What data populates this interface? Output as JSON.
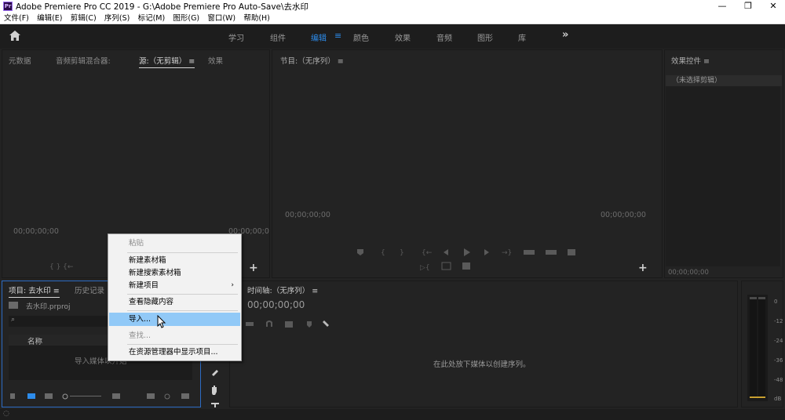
{
  "window": {
    "title": "Adobe Premiere Pro CC 2019 - G:\\Adobe Premiere Pro Auto-Save\\去水印",
    "logo": "Pr",
    "minimize": "—",
    "restore": "❐",
    "close": "✕"
  },
  "menubar": [
    "文件(F)",
    "编辑(E)",
    "剪辑(C)",
    "序列(S)",
    "标记(M)",
    "图形(G)",
    "窗口(W)",
    "帮助(H)"
  ],
  "workspaces": {
    "items": [
      "学习",
      "组件",
      "编辑",
      "颜色",
      "效果",
      "音频",
      "图形",
      "库"
    ],
    "active": "编辑",
    "menu_icon": "≡",
    "more_icon": "»"
  },
  "source_panel": {
    "tabs": [
      "元数据",
      "音频剪辑混合器:",
      "源:（无剪辑）",
      "效果"
    ],
    "menu_icon": "≡",
    "timecode_left": "00;00;00;00",
    "timecode_right": "00;00;00;0",
    "controls": "{  }   {←",
    "add": "+"
  },
  "program_panel": {
    "title": "节目:（无序列）",
    "menu_icon": "≡",
    "timecode_left": "00;00;00;00",
    "timecode_right": "00;00;00;00",
    "add": "+"
  },
  "effects_panel": {
    "title": "效果控件",
    "menu_icon": "≡",
    "sub": "（未选择剪辑）",
    "timecode": "00;00;00;00"
  },
  "project_panel": {
    "tabs": [
      "项目: 去水印",
      "历史记录"
    ],
    "menu_icon": "≡",
    "file": "去水印.prproj",
    "column_name": "名称",
    "empty_hint": "导入媒体以开始"
  },
  "timeline_panel": {
    "title": "时间轴:（无序列）",
    "menu_icon": "≡",
    "timecode": "00;00;00;00",
    "empty_msg": "在此处放下媒体以创建序列。"
  },
  "meter_labels": [
    "0",
    "-12",
    "-24",
    "-36",
    "-48",
    "dB"
  ],
  "context_menu": {
    "items": [
      {
        "label": "粘贴",
        "disabled": true
      },
      {
        "label": "新建素材箱",
        "disabled": false
      },
      {
        "label": "新建搜索素材箱",
        "disabled": false
      },
      {
        "label": "新建项目",
        "disabled": false,
        "submenu": true
      },
      {
        "label": "查看隐藏内容",
        "disabled": false
      },
      {
        "label": "导入...",
        "disabled": false,
        "highlighted": true
      },
      {
        "label": "查找...",
        "disabled": true
      },
      {
        "label": "在资源管理器中显示项目...",
        "disabled": false
      }
    ],
    "submenu_arrow": "›"
  },
  "colors": {
    "accent": "#2d8ceb",
    "highlight": "#91c9f7",
    "panel_bg": "#232323"
  }
}
